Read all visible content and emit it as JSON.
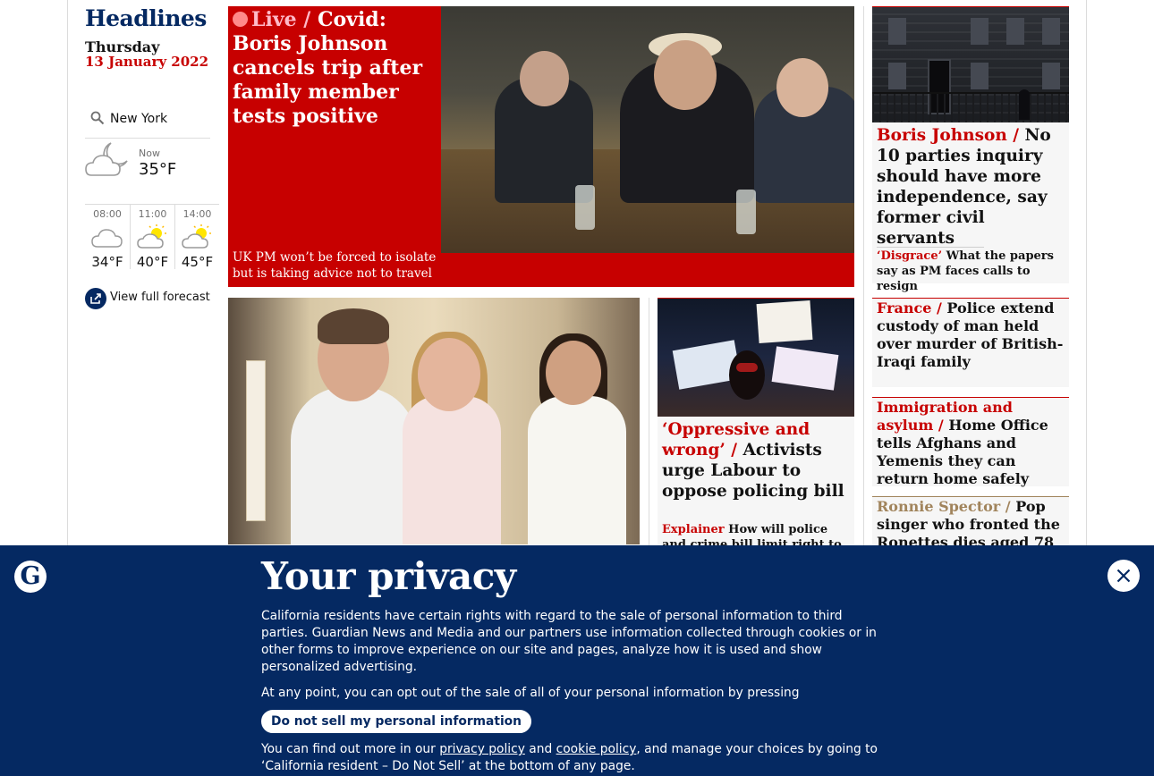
{
  "sidebar": {
    "title": "Headlines",
    "day": "Thursday",
    "date": "13 January 2022",
    "location": "New York",
    "now_label": "Now",
    "now_temp": "35°F",
    "hourly": [
      {
        "time": "08:00",
        "temp": "34°F",
        "icon": "cloud-icon"
      },
      {
        "time": "11:00",
        "temp": "40°F",
        "icon": "partly-sunny-icon"
      },
      {
        "time": "14:00",
        "temp": "45°F",
        "icon": "partly-sunny-icon"
      }
    ],
    "forecast_link": "View full forecast"
  },
  "main_story": {
    "kicker": "Live /",
    "headline": "Covid: Boris Johnson cancels trip after family member tests positive",
    "standfirst": "UK PM won’t be forced to isolate but is taking advice not to travel"
  },
  "protest_story": {
    "kicker": "‘Oppressive and wrong’ /",
    "headline": "Activists urge Labour to oppose policing bill",
    "sub_kicker": "Explainer",
    "sub_headline": "How will police and crime bill limit right to protest?"
  },
  "right_column": [
    {
      "kicker": "Boris Johnson /",
      "headline": "No 10 parties inquiry should have more independence, say former civil servants",
      "sub_kicker": "‘Disgrace’",
      "sub_headline": "What the papers say as PM faces calls to resign"
    },
    {
      "kicker": "France /",
      "headline": "Police extend custody of man held over murder of British-Iraqi family"
    },
    {
      "kicker": "Immigration and asylum /",
      "headline": "Home Office tells Afghans and Yemenis they can return home safely"
    },
    {
      "kicker": "Ronnie Spector /",
      "headline": "Pop singer who fronted the Ronettes dies aged 78"
    }
  ],
  "privacy": {
    "logo_letter": "G",
    "title": "Your privacy",
    "paragraph_1": "California residents have certain rights with regard to the sale of personal information to third parties. Guardian News and Media and our partners use information collected through cookies or in other forms to improve experience on our site and pages, analyze how it is used and show personalized advertising.",
    "paragraph_2": "At any point, you can opt out of the sale of all of your personal information by pressing",
    "button_label": "Do not sell my personal information",
    "p3_before": "You can find out more in our ",
    "privacy_link": "privacy policy",
    "p3_and": " and ",
    "cookie_link": "cookie policy",
    "p3_after": ", and manage your choices by going to ‘California resident – Do Not Sell’ at the bottom of any page."
  },
  "colors": {
    "brand_navy": "#052962",
    "news_red": "#c70000",
    "culture_gold": "#a1845c"
  }
}
